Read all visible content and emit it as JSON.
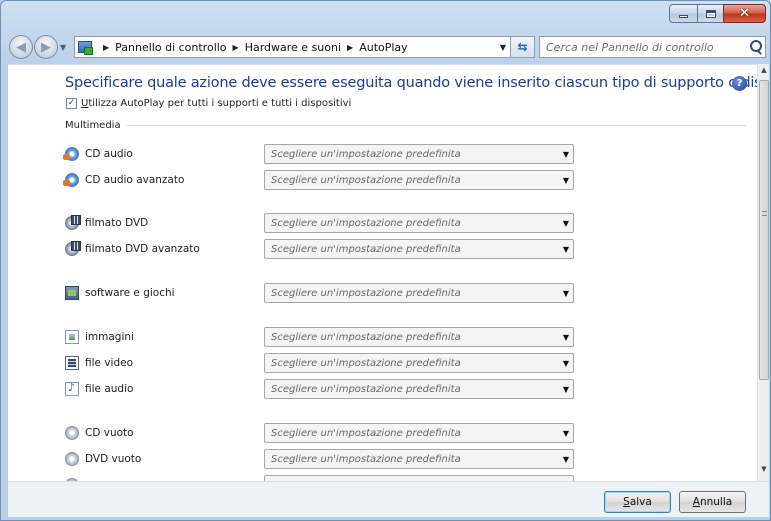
{
  "window": {
    "controls": {
      "minimize_icon": "minimize-icon",
      "maximize_icon": "maximize-icon",
      "close_icon": "close-icon",
      "close_glyph": "✕"
    }
  },
  "address": {
    "breadcrumbs": [
      "Pannello di controllo",
      "Hardware e suoni",
      "AutoPlay"
    ],
    "search_placeholder": "Cerca nel Pannello di controllo"
  },
  "content": {
    "title": "Specificare quale azione deve essere eseguita quando viene inserito ciascun tipo di supporto o dispositivo",
    "master_checkbox": {
      "label": "Utilizza AutoPlay per tutti i supporti e tutti i dispositivi",
      "checked": true
    },
    "group_label": "Multimedia",
    "select_placeholder": "Scegliere un'impostazione predefinita",
    "items": [
      {
        "label": "CD audio",
        "icon": "cd-audio-icon"
      },
      {
        "label": "CD audio avanzato",
        "icon": "cd-audio-icon"
      },
      {
        "label": "filmato DVD",
        "icon": "dvd-movie-icon"
      },
      {
        "label": "filmato DVD avanzato",
        "icon": "dvd-movie-icon"
      },
      {
        "label": "software e giochi",
        "icon": "software-icon"
      },
      {
        "label": "immagini",
        "icon": "image-icon"
      },
      {
        "label": "file video",
        "icon": "video-file-icon"
      },
      {
        "label": "file audio",
        "icon": "audio-file-icon"
      },
      {
        "label": "CD vuoto",
        "icon": "blank-cd-icon"
      },
      {
        "label": "DVD vuoto",
        "icon": "blank-dvd-icon"
      }
    ]
  },
  "footer": {
    "save_label": "Salva",
    "cancel_label": "Annulla"
  },
  "colors": {
    "title": "#1a3e8a",
    "accent": "#3c7fb1",
    "close_button": "#c1331c"
  }
}
